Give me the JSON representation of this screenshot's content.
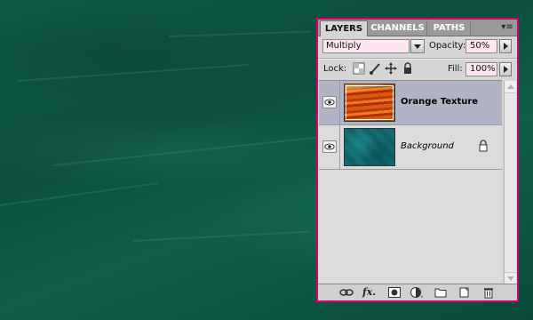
{
  "panel": {
    "tabs": [
      {
        "label": "LAYERS",
        "active": true
      },
      {
        "label": "CHANNELS",
        "active": false
      },
      {
        "label": "PATHS",
        "active": false
      }
    ],
    "menu_icon": "panel-menu-icon",
    "blend_mode": "Multiply",
    "opacity_label": "Opacity:",
    "opacity_value": "50%",
    "lock_label": "Lock:",
    "fill_label": "Fill:",
    "fill_value": "100%",
    "layers": [
      {
        "name": "Orange Texture",
        "selected": true,
        "visible": true,
        "locked": false
      },
      {
        "name": "Background",
        "selected": false,
        "visible": true,
        "locked": true
      }
    ],
    "bottom_icons": [
      "link-layers-icon",
      "fx-icon",
      "add-mask-icon",
      "adjustment-layer-icon",
      "new-group-icon",
      "new-layer-icon",
      "trash-icon"
    ],
    "fx_text": "fx."
  },
  "colors": {
    "panel_border": "#d0006f",
    "selected_layer": "#b3b3c6",
    "canvas": "#0d5a46"
  }
}
